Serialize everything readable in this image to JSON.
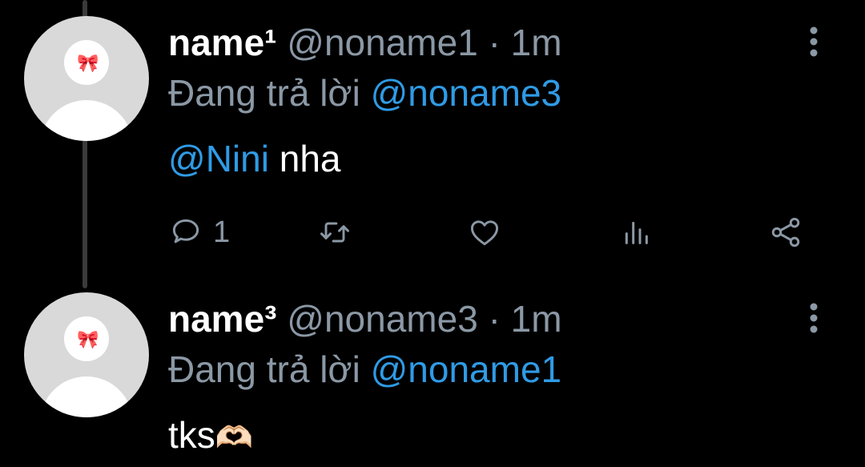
{
  "tweets": [
    {
      "display_name": "name¹",
      "handle": "@noname1",
      "separator": "·",
      "time": "1m",
      "reply_prefix": "Đang trả lời",
      "reply_to": "@noname3",
      "mention": "@Nini",
      "text": "nha",
      "reply_count": "1"
    },
    {
      "display_name": "name³",
      "handle": "@noname3",
      "separator": "·",
      "time": "1m",
      "reply_prefix": "Đang trả lời",
      "reply_to": "@noname1",
      "text": "tks",
      "emoji": "🫶🏻"
    }
  ],
  "colors": {
    "background": "#000000",
    "text": "#ffffff",
    "secondary": "#8b98a5",
    "link": "#2f9be5",
    "avatar": "#d9d9d9"
  },
  "icons": [
    "reply-icon",
    "retweet-icon",
    "like-icon",
    "views-icon",
    "share-icon",
    "more-icon",
    "bow-icon"
  ]
}
